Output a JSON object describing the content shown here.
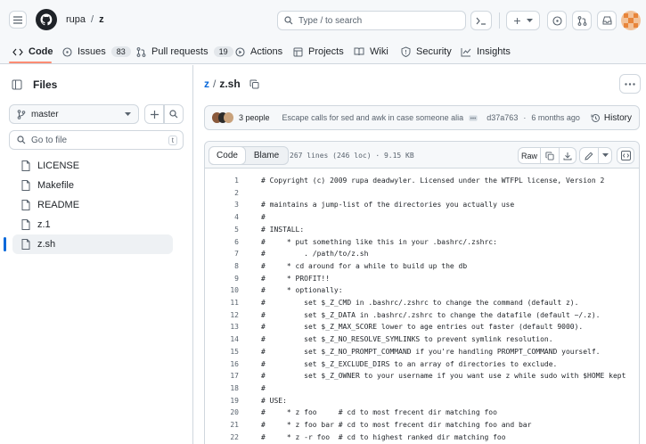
{
  "header": {
    "owner": "rupa",
    "separator": "/",
    "repo": "z",
    "search_placeholder": "Type / to search",
    "plus_label": "+"
  },
  "tabs": [
    {
      "label": "Code",
      "icon": "code-icon"
    },
    {
      "label": "Issues",
      "count": "83",
      "icon": "issue-icon"
    },
    {
      "label": "Pull requests",
      "count": "19",
      "icon": "pull-request-icon"
    },
    {
      "label": "Actions",
      "icon": "play-icon"
    },
    {
      "label": "Projects",
      "icon": "table-icon"
    },
    {
      "label": "Wiki",
      "icon": "book-icon"
    },
    {
      "label": "Security",
      "icon": "shield-icon"
    },
    {
      "label": "Insights",
      "icon": "graph-icon"
    }
  ],
  "sidebar": {
    "title": "Files",
    "branch": "master",
    "filter_placeholder": "Go to file",
    "shortcut": "t",
    "files": [
      "LICENSE",
      "Makefile",
      "README",
      "z.1",
      "z.sh"
    ],
    "selected_index": 4
  },
  "breadcrumb": {
    "repo": "z",
    "separator": "/",
    "file": "z.sh"
  },
  "commit": {
    "people": "3 people",
    "message": "Escape calls for sed and awk in case someone aliase...",
    "hash": "d37a763",
    "time_sep": "·",
    "time": "6 months ago",
    "history_label": "History"
  },
  "file_header": {
    "code_tab": "Code",
    "blame_tab": "Blame",
    "meta": "267 lines (246 loc) · 9.15 KB",
    "raw_label": "Raw"
  },
  "code_lines": [
    {
      "n": "1",
      "t": "# Copyright (c) 2009 rupa deadwyler. Licensed under the WTFPL license, Version 2"
    },
    {
      "n": "2",
      "t": ""
    },
    {
      "n": "3",
      "t": "# maintains a jump-list of the directories you actually use"
    },
    {
      "n": "4",
      "t": "#"
    },
    {
      "n": "5",
      "t": "# INSTALL:"
    },
    {
      "n": "6",
      "t": "#     * put something like this in your .bashrc/.zshrc:"
    },
    {
      "n": "7",
      "t": "#         . /path/to/z.sh"
    },
    {
      "n": "8",
      "t": "#     * cd around for a while to build up the db"
    },
    {
      "n": "9",
      "t": "#     * PROFIT!!"
    },
    {
      "n": "10",
      "t": "#     * optionally:"
    },
    {
      "n": "11",
      "t": "#         set $_Z_CMD in .bashrc/.zshrc to change the command (default z)."
    },
    {
      "n": "12",
      "t": "#         set $_Z_DATA in .bashrc/.zshrc to change the datafile (default ~/.z)."
    },
    {
      "n": "13",
      "t": "#         set $_Z_MAX_SCORE lower to age entries out faster (default 9000)."
    },
    {
      "n": "14",
      "t": "#         set $_Z_NO_RESOLVE_SYMLINKS to prevent symlink resolution."
    },
    {
      "n": "15",
      "t": "#         set $_Z_NO_PROMPT_COMMAND if you're handling PROMPT_COMMAND yourself."
    },
    {
      "n": "16",
      "t": "#         set $_Z_EXCLUDE_DIRS to an array of directories to exclude."
    },
    {
      "n": "17",
      "t": "#         set $_Z_OWNER to your username if you want use z while sudo with $HOME kept"
    },
    {
      "n": "18",
      "t": "#"
    },
    {
      "n": "19",
      "t": "# USE:"
    },
    {
      "n": "20",
      "t": "#     * z foo     # cd to most frecent dir matching foo"
    },
    {
      "n": "21",
      "t": "#     * z foo bar # cd to most frecent dir matching foo and bar"
    },
    {
      "n": "22",
      "t": "#     * z -r foo  # cd to highest ranked dir matching foo"
    }
  ]
}
